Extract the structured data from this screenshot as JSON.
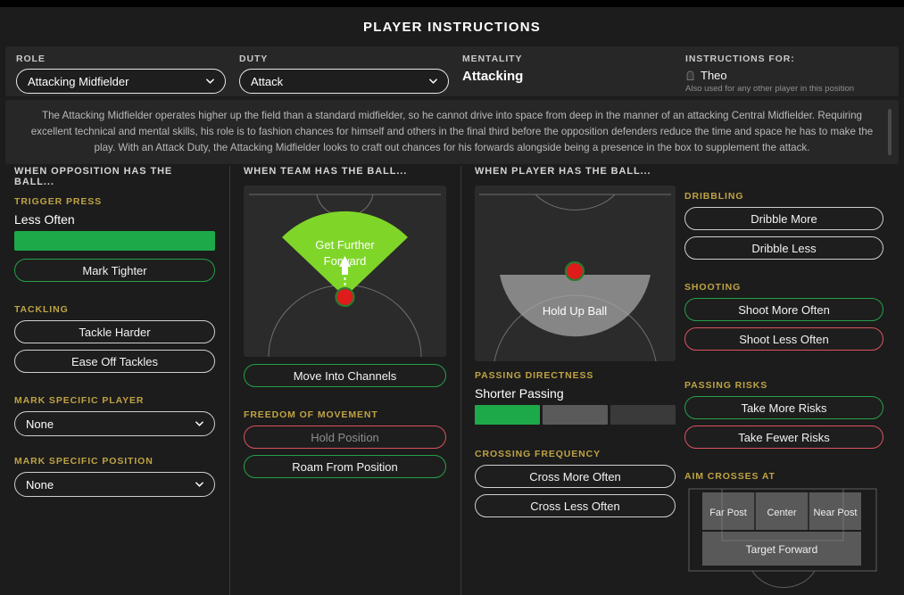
{
  "header": {
    "title": "PLAYER INSTRUCTIONS"
  },
  "selectors": {
    "role_label": "ROLE",
    "role_value": "Attacking Midfielder",
    "duty_label": "DUTY",
    "duty_value": "Attack",
    "mentality_label": "MENTALITY",
    "mentality_value": "Attacking",
    "instructions_for_label": "INSTRUCTIONS FOR:",
    "player_name": "Theo",
    "player_note": "Also used for any other player in this position",
    "player_icon": "player-avatar-icon",
    "chevron_icon": "chevron-down-icon"
  },
  "description": {
    "text": "The Attacking Midfielder operates higher up the field than a standard midfielder, so he cannot drive into space from deep in the manner of an attacking Central Midfielder. Requiring excellent technical and mental skills, his role is to fashion chances for himself and others in the final third before the opposition defenders reduce the time and space he has to make the play. With an Attack Duty, the Attacking Midfielder looks to craft out chances for his forwards alongside being a presence in the box to supplement the attack."
  },
  "col_opposition": {
    "heading": "WHEN OPPOSITION HAS THE BALL...",
    "trigger_press": {
      "label": "TRIGGER PRESS",
      "value": "Less Often",
      "fill_color": "#1DA94A"
    },
    "mark_tighter": {
      "label": "Mark Tighter",
      "state": "green"
    },
    "tackling": {
      "label": "TACKLING",
      "options": [
        {
          "label": "Tackle Harder",
          "state": "off"
        },
        {
          "label": "Ease Off Tackles",
          "state": "off"
        }
      ]
    },
    "mark_specific_player": {
      "label": "MARK SPECIFIC PLAYER",
      "value": "None"
    },
    "mark_specific_position": {
      "label": "MARK SPECIFIC POSITION",
      "value": "None"
    }
  },
  "col_team": {
    "heading": "WHEN TEAM HAS THE BALL...",
    "pitch_label": "Get Further Forward",
    "cone_color": "#7FD629",
    "marker_color": "#e01b1b",
    "move_into_channels": {
      "label": "Move Into Channels",
      "state": "green"
    },
    "freedom": {
      "label": "FREEDOM OF MOVEMENT",
      "options": [
        {
          "label": "Hold Position",
          "state": "red-dim"
        },
        {
          "label": "Roam From Position",
          "state": "green"
        }
      ]
    }
  },
  "col_player": {
    "heading": "WHEN PLAYER HAS THE BALL...",
    "pitch_label": "Hold Up Ball",
    "dome_color": "#a9a9a9",
    "passing_directness": {
      "label": "PASSING DIRECTNESS",
      "value": "Shorter Passing",
      "segments": [
        "active",
        "mid",
        "dark"
      ]
    },
    "crossing_frequency": {
      "label": "CROSSING FREQUENCY",
      "options": [
        {
          "label": "Cross More Often",
          "state": "off"
        },
        {
          "label": "Cross Less Often",
          "state": "off"
        }
      ]
    }
  },
  "col_right": {
    "dribbling": {
      "label": "DRIBBLING",
      "options": [
        {
          "label": "Dribble More",
          "state": "off"
        },
        {
          "label": "Dribble Less",
          "state": "off"
        }
      ]
    },
    "shooting": {
      "label": "SHOOTING",
      "options": [
        {
          "label": "Shoot More Often",
          "state": "green"
        },
        {
          "label": "Shoot Less Often",
          "state": "red"
        }
      ]
    },
    "passing_risks": {
      "label": "PASSING RISKS",
      "options": [
        {
          "label": "Take More Risks",
          "state": "green"
        },
        {
          "label": "Take Fewer Risks",
          "state": "red"
        }
      ]
    },
    "aim_crosses": {
      "label": "AIM CROSSES AT",
      "zones": [
        "Far Post",
        "Center",
        "Near Post"
      ],
      "target": "Target Forward"
    }
  }
}
